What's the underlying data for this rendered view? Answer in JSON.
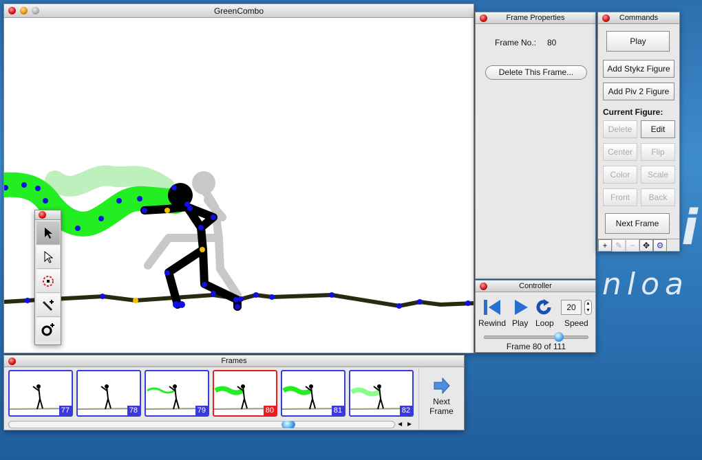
{
  "background": {
    "text1": "nloa",
    "text2": "i"
  },
  "main_window": {
    "title": "GreenCombo"
  },
  "tools": [
    "select-arrow-icon",
    "hollow-arrow-icon",
    "center-target-icon",
    "add-line-icon",
    "add-circle-icon"
  ],
  "frame_properties": {
    "title": "Frame Properties",
    "frame_label": "Frame No.:",
    "frame_value": "80",
    "delete_button": "Delete This Frame..."
  },
  "commands": {
    "title": "Commands",
    "play": "Play",
    "add_stykz": "Add Stykz Figure",
    "add_piv2": "Add Piv 2 Figure",
    "current_figure": "Current Figure:",
    "delete": "Delete",
    "edit": "Edit",
    "center": "Center",
    "flip": "Flip",
    "color": "Color",
    "scale": "Scale",
    "front": "Front",
    "back": "Back",
    "next_frame": "Next Frame",
    "bottom_tools": [
      "+",
      "✎",
      "−",
      "✥",
      "⚙"
    ]
  },
  "controller": {
    "title": "Controller",
    "rewind": "Rewind",
    "play": "Play",
    "loop": "Loop",
    "speed_label": "Speed",
    "speed_value": "20",
    "status": "Frame 80 of 111",
    "current_frame": 80,
    "total_frames": 111
  },
  "frames": {
    "title": "Frames",
    "items": [
      {
        "num": "77"
      },
      {
        "num": "78"
      },
      {
        "num": "79"
      },
      {
        "num": "80",
        "selected": true
      },
      {
        "num": "81"
      },
      {
        "num": "82"
      }
    ],
    "next_label1": "Next",
    "next_label2": "Frame"
  },
  "colors": {
    "selected": "#e62020",
    "frame_border": "#3a3ad8",
    "trail": "#22ee22",
    "joint": "#1010e0",
    "pivot": "#f0c000"
  }
}
